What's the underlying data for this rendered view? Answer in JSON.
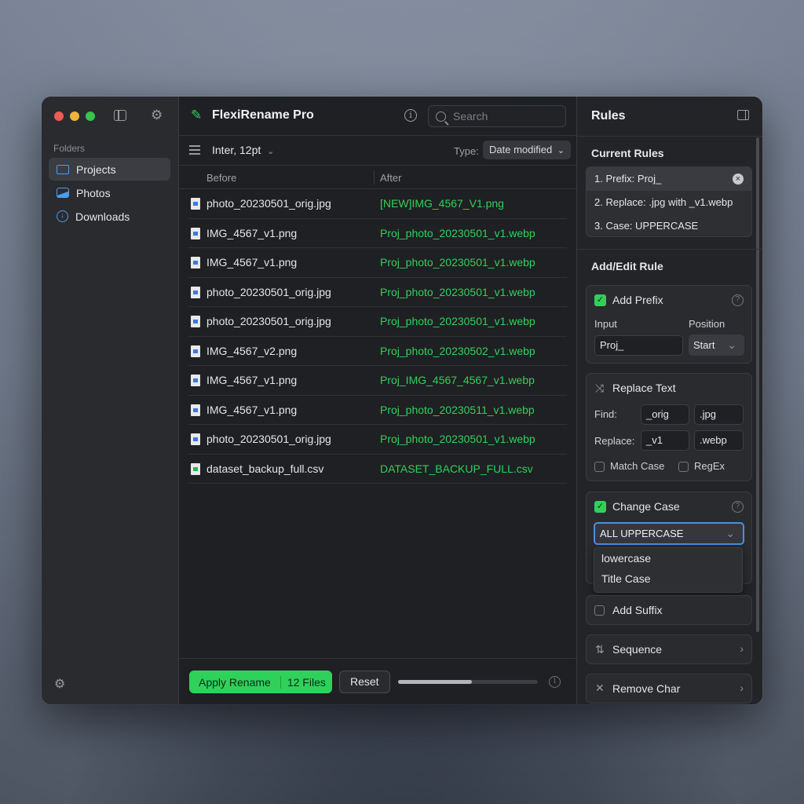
{
  "sidebar": {
    "folders_label": "Folders",
    "items": [
      {
        "label": "Projects",
        "icon": "folder-icon",
        "active": true
      },
      {
        "label": "Photos",
        "icon": "photo-icon",
        "active": false
      },
      {
        "label": "Downloads",
        "icon": "download-icon",
        "active": false
      }
    ]
  },
  "header": {
    "title": "FlexiRename Pro",
    "search_placeholder": "Search"
  },
  "toolbar": {
    "font": "Inter, 12pt",
    "type_label": "Type:",
    "type_value": "Date modified"
  },
  "table": {
    "columns": [
      "Before",
      "After"
    ],
    "rows": [
      {
        "before": "photo_20230501_orig.jpg",
        "after": "[NEW]IMG_4567_V1.png",
        "type": "image"
      },
      {
        "before": "IMG_4567_v1.png",
        "after": "Proj_photo_20230501_v1.webp",
        "type": "image"
      },
      {
        "before": "IMG_4567_v1.png",
        "after": "Proj_photo_20230501_v1.webp",
        "type": "image"
      },
      {
        "before": "photo_20230501_orig.jpg",
        "after": "Proj_photo_20230501_v1.webp",
        "type": "image"
      },
      {
        "before": "photo_20230501_orig.jpg",
        "after": "Proj_photo_20230501_v1.webp",
        "type": "image"
      },
      {
        "before": "IMG_4567_v2.png",
        "after": "Proj_photo_20230502_v1.webp",
        "type": "image"
      },
      {
        "before": "IMG_4567_v1.png",
        "after": "Proj_IMG_4567_4567_v1.webp",
        "type": "image"
      },
      {
        "before": "IMG_4567_v1.png",
        "after": "Proj_photo_20230511_v1.webp",
        "type": "image"
      },
      {
        "before": "photo_20230501_orig.jpg",
        "after": "Proj_photo_20230501_v1.webp",
        "type": "image"
      },
      {
        "before": "dataset_backup_full.csv",
        "after": "DATASET_BACKUP_FULL.csv",
        "type": "csv"
      }
    ]
  },
  "footer": {
    "apply_label": "Apply Rename",
    "apply_count": "12 Files",
    "reset_label": "Reset",
    "progress": 0.53
  },
  "rules": {
    "title": "Rules",
    "current_label": "Current Rules",
    "current": [
      "1. Prefix: Proj_",
      "2. Replace: .jpg with _v1.webp",
      "3. Case: UPPERCASE"
    ],
    "add_edit_label": "Add/Edit Rule",
    "prefix": {
      "title": "Add Prefix",
      "checked": true,
      "input_label": "Input",
      "input_value": "Proj_",
      "position_label": "Position",
      "position_value": "Start"
    },
    "replace": {
      "title": "Replace Text",
      "find_label": "Find:",
      "find_1": "_orig",
      "find_2": ".jpg",
      "replace_label": "Replace:",
      "replace_1": "_v1",
      "replace_2": ".webp",
      "match_case": "Match Case",
      "regex": "RegEx"
    },
    "change_case": {
      "title": "Change Case",
      "checked": true,
      "selected": "ALL UPPERCASE",
      "options": [
        "lowercase",
        "Title Case"
      ]
    },
    "suffix": {
      "title": "Add Suffix",
      "checked": false
    },
    "sequence": {
      "title": "Sequence"
    },
    "remove_char": {
      "title": "Remove Char"
    }
  },
  "colors": {
    "accent": "#2fd15b",
    "focus": "#4a8fe0",
    "folder": "#4a9df0"
  }
}
